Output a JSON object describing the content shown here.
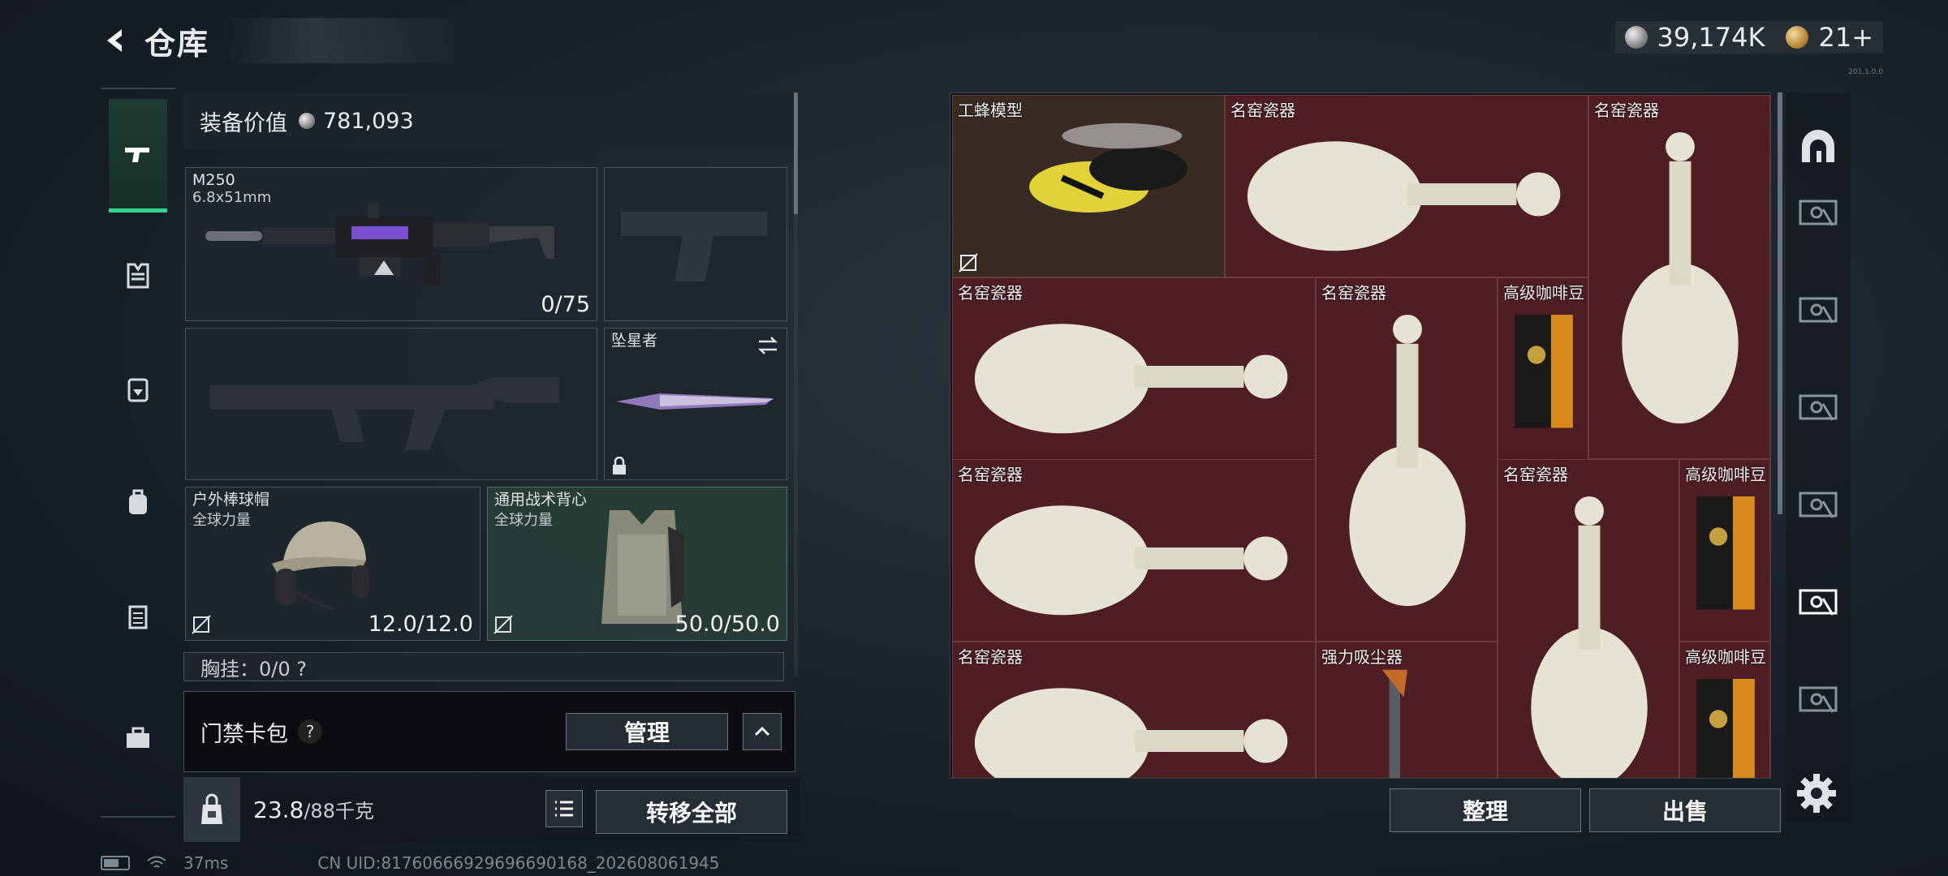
{
  "header": {
    "title": "仓库"
  },
  "currency": {
    "silver_amount": "39,174K",
    "gold_amount": "21+",
    "small_code": "201.1.0.0"
  },
  "nav": {
    "items": [
      {
        "name": "weapon"
      },
      {
        "name": "armor"
      },
      {
        "name": "helmet-pack"
      },
      {
        "name": "backpack"
      },
      {
        "name": "vest"
      },
      {
        "name": "case"
      }
    ]
  },
  "equipment": {
    "value_label": "装备价值",
    "value_amount": "781,093",
    "primary": {
      "name": "M250",
      "ammo": "6.8x51mm",
      "count": "0/75"
    },
    "melee": {
      "name": "坠星者"
    },
    "helmet": {
      "name": "户外棒球帽",
      "sub": "全球力量",
      "durability": "12.0/12.0"
    },
    "vest": {
      "name": "通用战术背心",
      "sub": "全球力量",
      "durability": "50.0/50.0"
    },
    "chest_partial": "胸挂：0/0 ?"
  },
  "keycard": {
    "label": "门禁卡包",
    "help": "?",
    "manage_label": "管理"
  },
  "weight": {
    "current": "23.8",
    "max": "/88千克",
    "transfer_label": "转移全部"
  },
  "status": {
    "ping": "37ms",
    "uid": "CN UID:8176066692969669016​8_202608061945"
  },
  "storage": {
    "items": [
      {
        "label": "工蜂模型",
        "kind": "bee"
      },
      {
        "label": "名窑瓷器",
        "kind": "vase-h"
      },
      {
        "label": "名窑瓷器",
        "kind": "vase-v"
      },
      {
        "label": "名窑瓷器",
        "kind": "vase-h"
      },
      {
        "label": "名窑瓷器",
        "kind": "vase-v"
      },
      {
        "label": "高级咖啡豆",
        "kind": "coffee"
      },
      {
        "label": "名窑瓷器",
        "kind": "vase-h"
      },
      {
        "label": "名窑瓷器",
        "kind": "vase-v"
      },
      {
        "label": "高级咖啡豆",
        "kind": "coffee"
      },
      {
        "label": "名窑瓷器",
        "kind": "vase-h"
      },
      {
        "label": "强力吸尘器",
        "kind": "vacuum"
      },
      {
        "label": "高级咖啡豆",
        "kind": "coffee"
      }
    ],
    "organize_label": "整理",
    "sell_label": "出售"
  }
}
